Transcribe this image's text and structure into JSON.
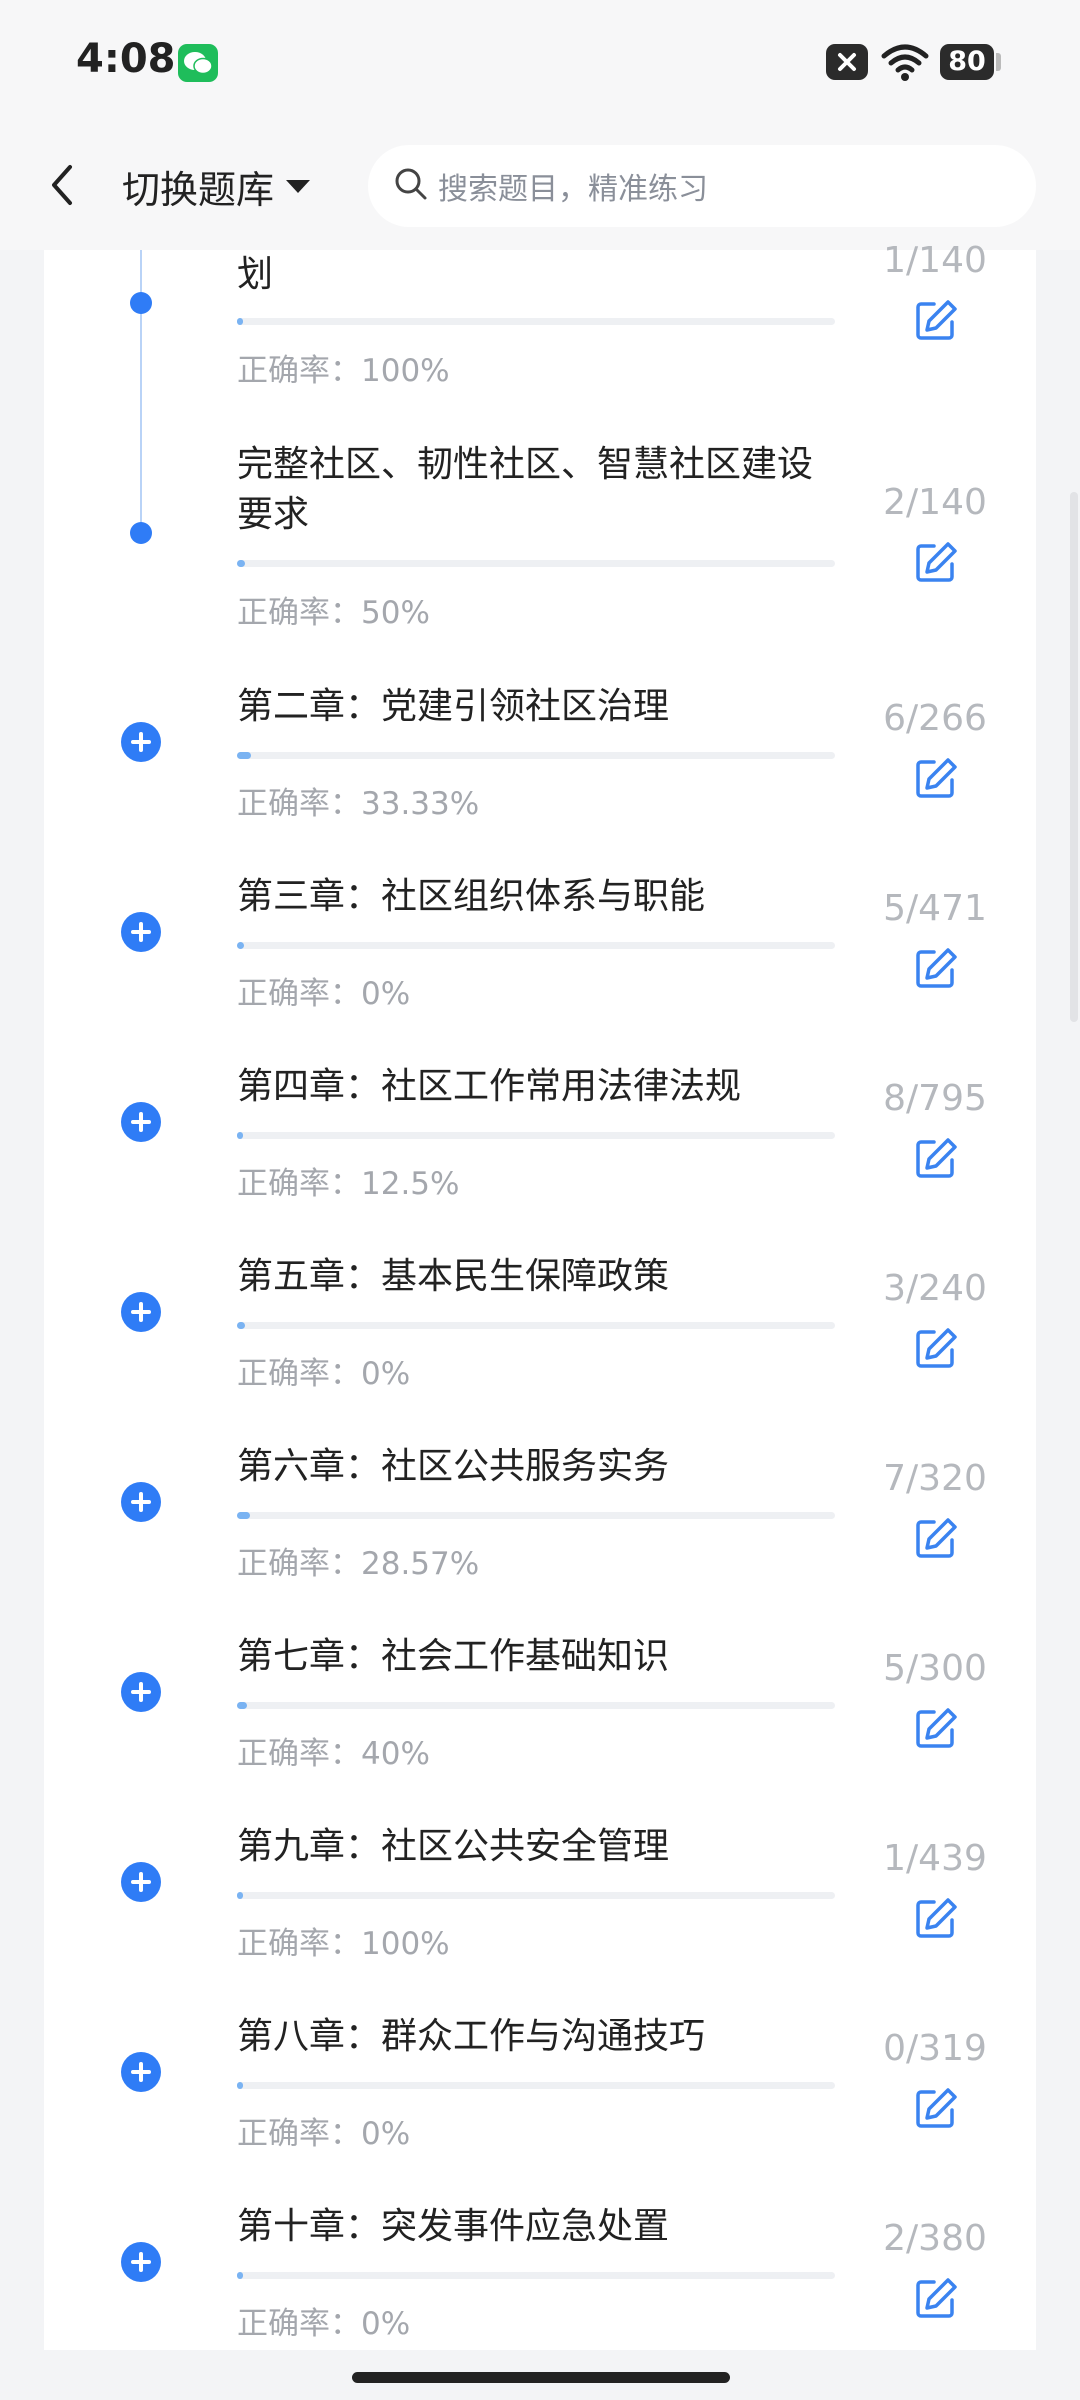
{
  "status_bar": {
    "time": "4:08",
    "battery": "80"
  },
  "header": {
    "bank_switch_label": "切换题库",
    "search_placeholder": "搜索题目，精准练习"
  },
  "colors": {
    "accent": "#2f7cf6",
    "progress": "#7ab3f2"
  },
  "items": [
    {
      "title": "划",
      "count": "1/140",
      "accuracy": "正确率：100%",
      "progress": 0.007,
      "marker": "dot"
    },
    {
      "title": "完整社区、韧性社区、智慧社区建设要求",
      "count": "2/140",
      "accuracy": "正确率：50%",
      "progress": 0.014,
      "marker": "dot"
    },
    {
      "title": "第二章：党建引领社区治理",
      "count": "6/266",
      "accuracy": "正确率：33.33%",
      "progress": 0.023,
      "marker": "plus"
    },
    {
      "title": "第三章：社区组织体系与职能",
      "count": "5/471",
      "accuracy": "正确率：0%",
      "progress": 0.011,
      "marker": "plus"
    },
    {
      "title": "第四章：社区工作常用法律法规",
      "count": "8/795",
      "accuracy": "正确率：12.5%",
      "progress": 0.01,
      "marker": "plus"
    },
    {
      "title": "第五章：基本民生保障政策",
      "count": "3/240",
      "accuracy": "正确率：0%",
      "progress": 0.013,
      "marker": "plus"
    },
    {
      "title": "第六章：社区公共服务实务",
      "count": "7/320",
      "accuracy": "正确率：28.57%",
      "progress": 0.022,
      "marker": "plus"
    },
    {
      "title": "第七章：社会工作基础知识",
      "count": "5/300",
      "accuracy": "正确率：40%",
      "progress": 0.017,
      "marker": "plus"
    },
    {
      "title": "第九章：社区公共安全管理",
      "count": "1/439",
      "accuracy": "正确率：100%",
      "progress": 0.002,
      "marker": "plus"
    },
    {
      "title": "第八章：群众工作与沟通技巧",
      "count": "0/319",
      "accuracy": "正确率：0%",
      "progress": 0.0,
      "marker": "plus"
    },
    {
      "title": "第十章：突发事件应急处置",
      "count": "2/380",
      "accuracy": "正确率：0%",
      "progress": 0.005,
      "marker": "plus"
    }
  ]
}
